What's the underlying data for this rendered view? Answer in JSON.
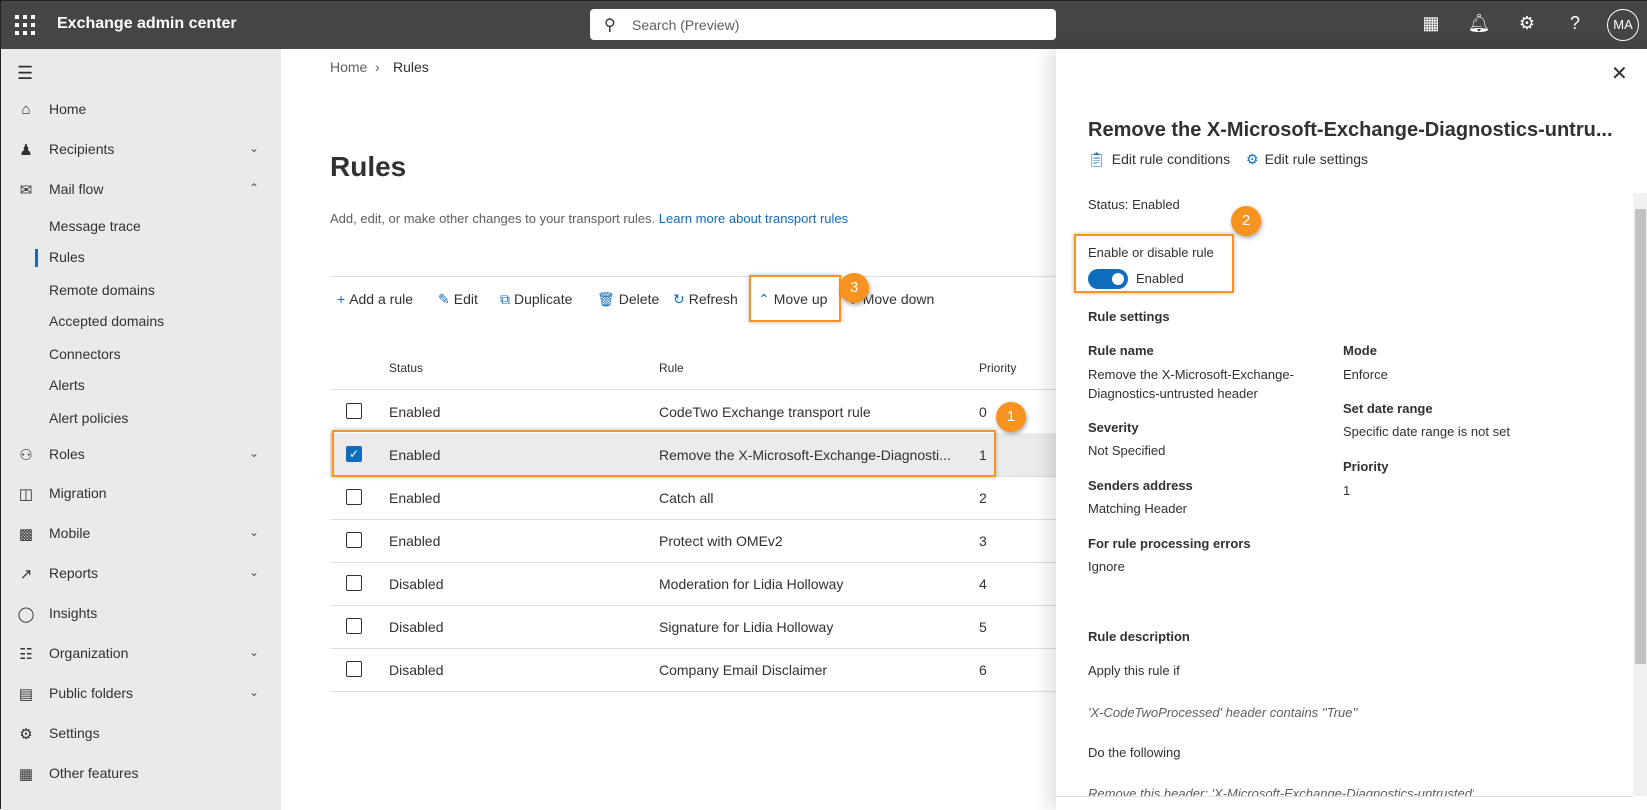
{
  "app": {
    "title": "Exchange admin center",
    "search_placeholder": "Search (Preview)",
    "avatar": "MA",
    "icons": [
      "waffle-icon",
      "terminal-icon",
      "bell-icon",
      "gear-icon",
      "help-icon"
    ]
  },
  "sidebar": {
    "items": [
      {
        "label": "Home",
        "icon": "home-icon"
      },
      {
        "label": "Recipients",
        "icon": "person-icon",
        "chevron": "down"
      },
      {
        "label": "Mail flow",
        "icon": "mail-icon",
        "chevron": "up"
      },
      {
        "label": "Message trace",
        "sub": true
      },
      {
        "label": "Rules",
        "sub": true,
        "selected": true
      },
      {
        "label": "Remote domains",
        "sub": true
      },
      {
        "label": "Accepted domains",
        "sub": true
      },
      {
        "label": "Connectors",
        "sub": true
      },
      {
        "label": "Alerts",
        "sub": true
      },
      {
        "label": "Alert policies",
        "sub": true
      },
      {
        "label": "Roles",
        "icon": "roles-icon",
        "chevron": "down"
      },
      {
        "label": "Migration",
        "icon": "migration-icon"
      },
      {
        "label": "Mobile",
        "icon": "mobile-icon",
        "chevron": "down"
      },
      {
        "label": "Reports",
        "icon": "chart-icon",
        "chevron": "down"
      },
      {
        "label": "Insights",
        "icon": "lightbulb-icon"
      },
      {
        "label": "Organization",
        "icon": "org-icon",
        "chevron": "down"
      },
      {
        "label": "Public folders",
        "icon": "folder-icon",
        "chevron": "down"
      },
      {
        "label": "Settings",
        "icon": "gear-icon"
      },
      {
        "label": "Other features",
        "icon": "grid-icon"
      }
    ]
  },
  "main": {
    "breadcrumb": [
      "Home",
      "Rules"
    ],
    "title": "Rules",
    "description": "Add, edit, or make other changes to your transport rules.",
    "learn_more": "Learn more about transport rules",
    "toolbar": {
      "add": "Add a rule",
      "edit": "Edit",
      "duplicate": "Duplicate",
      "delete": "Delete",
      "refresh": "Refresh",
      "move_up": "Move up",
      "move_down": "Move down"
    },
    "columns": {
      "status": "Status",
      "rule": "Rule",
      "priority": "Priority"
    },
    "rows": [
      {
        "status": "Enabled",
        "rule": "CodeTwo Exchange transport rule",
        "priority": "0",
        "checked": false
      },
      {
        "status": "Enabled",
        "rule": "Remove the X-Microsoft-Exchange-Diagnosti...",
        "priority": "1",
        "checked": true
      },
      {
        "status": "Enabled",
        "rule": "Catch all",
        "priority": "2",
        "checked": false
      },
      {
        "status": "Enabled",
        "rule": "Protect with OMEv2",
        "priority": "3",
        "checked": false
      },
      {
        "status": "Disabled",
        "rule": "Moderation for Lidia Holloway",
        "priority": "4",
        "checked": false
      },
      {
        "status": "Disabled",
        "rule": "Signature for Lidia Holloway",
        "priority": "5",
        "checked": false
      },
      {
        "status": "Disabled",
        "rule": "Company Email Disclaimer",
        "priority": "6",
        "checked": false
      }
    ]
  },
  "annotations": [
    "1",
    "2",
    "3"
  ],
  "panel": {
    "title": "Remove the X-Microsoft-Exchange-Diagnostics-untru...",
    "edit_conditions": "Edit rule conditions",
    "edit_settings": "Edit rule settings",
    "status": "Status: Enabled",
    "toggle_label": "Enable or disable rule",
    "toggle_state": "Enabled",
    "toggle_on": true,
    "rule_settings": "Rule settings",
    "rule_name_label": "Rule name",
    "rule_name_1": "Remove the X-Microsoft-Exchange-",
    "rule_name_2": "Diagnostics-untrusted header",
    "severity_label": "Severity",
    "severity": "Not Specified",
    "senders_label": "Senders address",
    "senders": "Matching Header",
    "errors_label": "For rule processing errors",
    "errors": "Ignore",
    "mode_label": "Mode",
    "mode": "Enforce",
    "date_label": "Set date range",
    "date": "Specific date range is not set",
    "priority_label": "Priority",
    "priority": "1",
    "desc_title": "Rule description",
    "apply_if": "Apply this rule if",
    "condition": "'X-CodeTwoProcessed' header contains ''True''",
    "do_following": "Do the following",
    "action": "Remove this header: 'X-Microsoft-Exchange-Diagnostics-untrusted'"
  },
  "colors": {
    "accent": "#0f6cbd",
    "annotation": "#f7931e",
    "topbar": "#464544"
  }
}
